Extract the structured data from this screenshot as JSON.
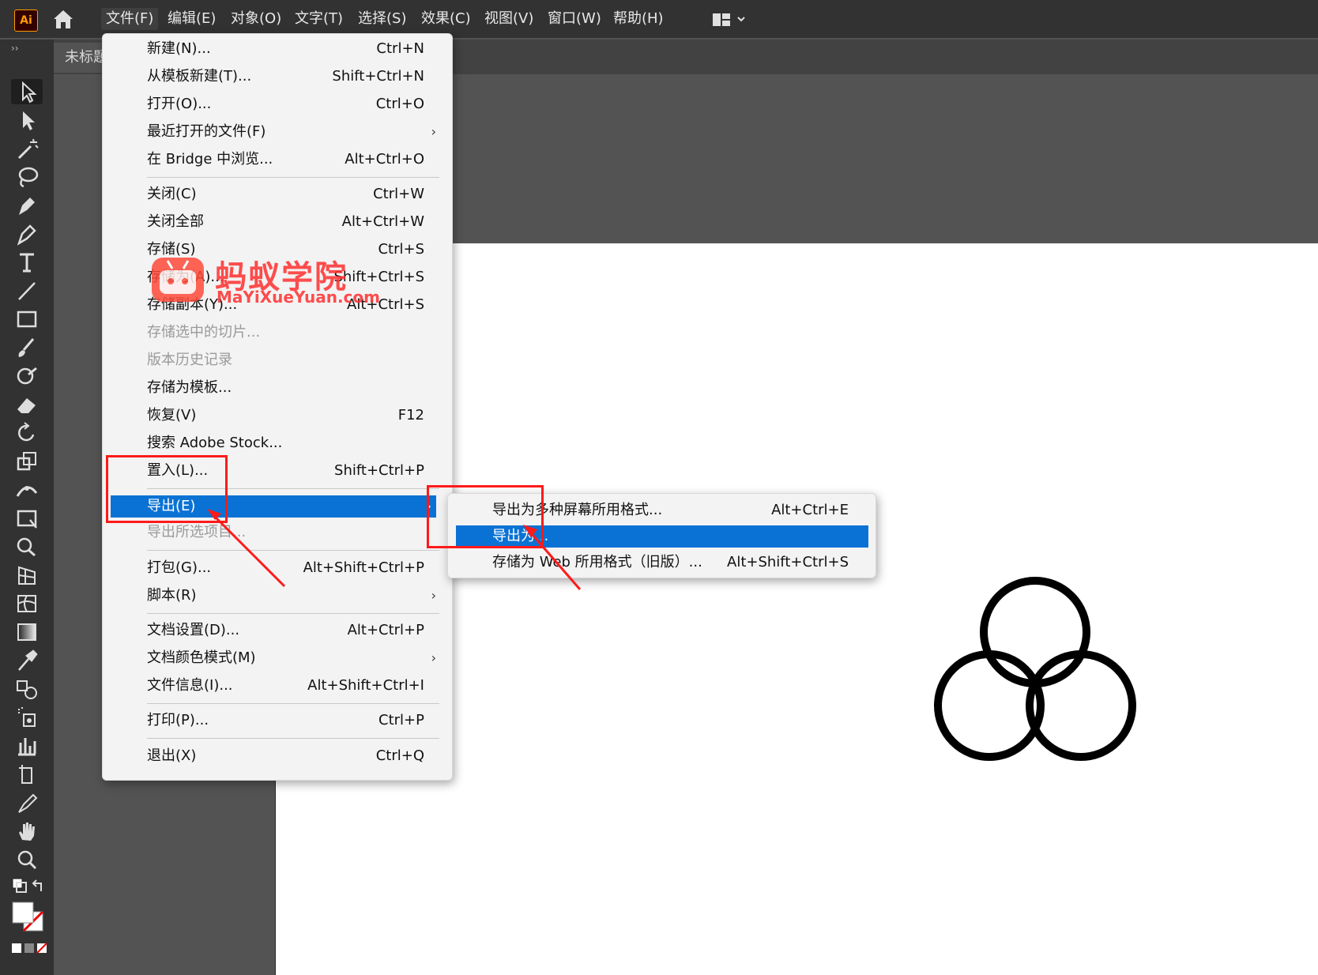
{
  "app": {
    "logo_text": "Ai"
  },
  "menubar": {
    "items": [
      "文件(F)",
      "编辑(E)",
      "对象(O)",
      "文字(T)",
      "选择(S)",
      "效果(C)",
      "视图(V)",
      "窗口(W)",
      "帮助(H)"
    ]
  },
  "document": {
    "tab_title": "未标题"
  },
  "toolbar": {
    "grip": "››"
  },
  "file_menu": {
    "items": [
      {
        "label": "新建(N)...",
        "shortcut": "Ctrl+N"
      },
      {
        "label": "从模板新建(T)...",
        "shortcut": "Shift+Ctrl+N"
      },
      {
        "label": "打开(O)...",
        "shortcut": "Ctrl+O"
      },
      {
        "label": "最近打开的文件(F)",
        "shortcut": "",
        "arrow": "›"
      },
      {
        "label": "在 Bridge 中浏览...",
        "shortcut": "Alt+Ctrl+O"
      },
      {
        "label": "关闭(C)",
        "shortcut": "Ctrl+W"
      },
      {
        "label": "关闭全部",
        "shortcut": "Alt+Ctrl+W"
      },
      {
        "label": "存储(S)",
        "shortcut": "Ctrl+S"
      },
      {
        "label": "存储为(A)...",
        "shortcut": "Shift+Ctrl+S"
      },
      {
        "label": "存储副本(Y)...",
        "shortcut": "Alt+Ctrl+S"
      },
      {
        "label": "存储选中的切片...",
        "shortcut": ""
      },
      {
        "label": "版本历史记录",
        "shortcut": ""
      },
      {
        "label": "存储为模板...",
        "shortcut": ""
      },
      {
        "label": "恢复(V)",
        "shortcut": "F12"
      },
      {
        "label": "搜索 Adobe Stock...",
        "shortcut": ""
      },
      {
        "label": "置入(L)...",
        "shortcut": "Shift+Ctrl+P"
      },
      {
        "label": "导出(E)",
        "shortcut": "",
        "arrow": "›"
      },
      {
        "label": "导出所选项目...",
        "shortcut": ""
      },
      {
        "label": "打包(G)...",
        "shortcut": "Alt+Shift+Ctrl+P"
      },
      {
        "label": "脚本(R)",
        "shortcut": "",
        "arrow": "›"
      },
      {
        "label": "文档设置(D)...",
        "shortcut": "Alt+Ctrl+P"
      },
      {
        "label": "文档颜色模式(M)",
        "shortcut": "",
        "arrow": "›"
      },
      {
        "label": "文件信息(I)...",
        "shortcut": "Alt+Shift+Ctrl+I"
      },
      {
        "label": "打印(P)...",
        "shortcut": "Ctrl+P"
      },
      {
        "label": "退出(X)",
        "shortcut": "Ctrl+Q"
      }
    ]
  },
  "export_submenu": {
    "items": [
      {
        "label": "导出为多种屏幕所用格式...",
        "shortcut": "Alt+Ctrl+E"
      },
      {
        "label": "导出为...",
        "shortcut": ""
      },
      {
        "label": "存储为 Web 所用格式（旧版）...",
        "shortcut": "Alt+Shift+Ctrl+S"
      }
    ]
  },
  "watermark": {
    "cn": "蚂蚁学院",
    "en": "MaYiXueYuan.com"
  },
  "colors": {
    "highlight": "#0a72d4",
    "annotation": "#ff1a1a",
    "menubar": "#323232"
  }
}
